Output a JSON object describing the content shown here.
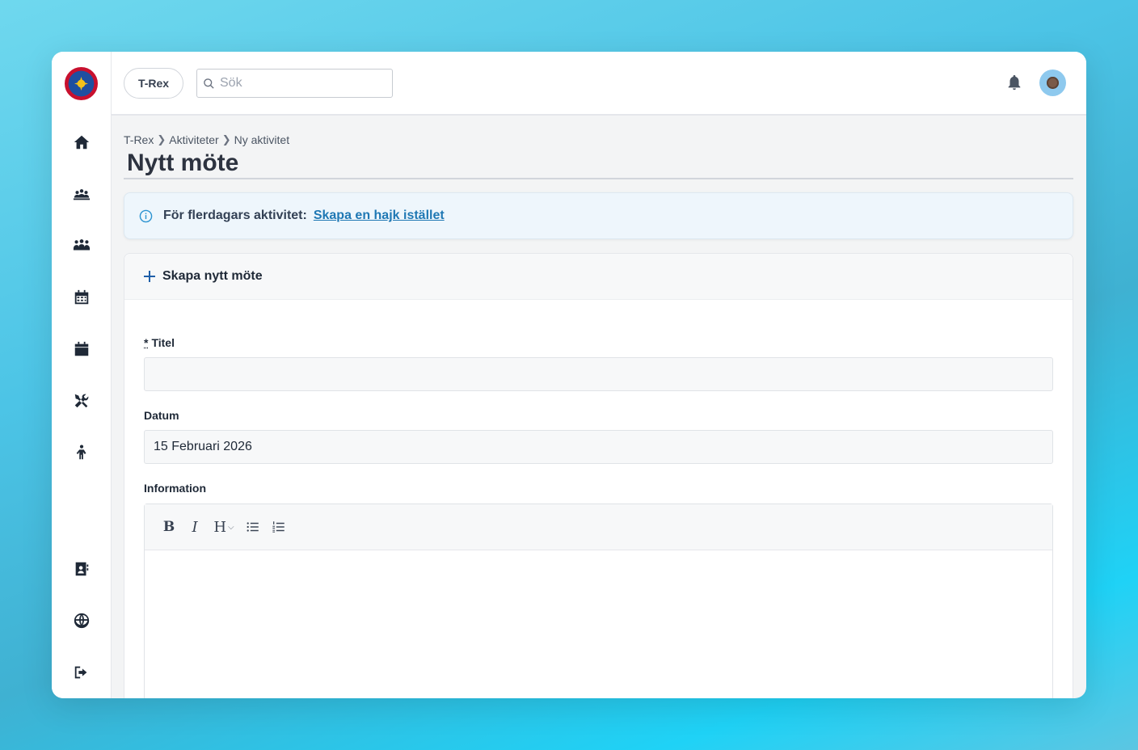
{
  "app": {
    "org_label": "T-Rex",
    "search": {
      "placeholder": "Sök"
    }
  },
  "sidebar": {
    "icons": [
      "home-icon",
      "group-icon",
      "people-icon",
      "calendar-grid-icon",
      "calendar-icon",
      "tools-icon",
      "person-icon",
      "contact-icon",
      "globe-icon",
      "logout-icon"
    ]
  },
  "breadcrumb": [
    "T-Rex",
    "Aktiviteter",
    "Ny aktivitet"
  ],
  "page": {
    "title": "Nytt möte"
  },
  "info": {
    "label": "För flerdagars aktivitet:",
    "link": "Skapa en hajk istället"
  },
  "form": {
    "header": "Skapa nytt möte",
    "title_required_mark": "*",
    "title_label": "Titel",
    "title_value": "",
    "date_label": "Datum",
    "date_value": "15 Februari 2026",
    "info_label": "Information",
    "toolbar": {
      "bold": "B",
      "italic": "I",
      "heading": "H"
    }
  },
  "colors": {
    "accent": "#1f78b4",
    "brand_red": "#c8102e",
    "brand_blue": "#1e4fa0"
  }
}
